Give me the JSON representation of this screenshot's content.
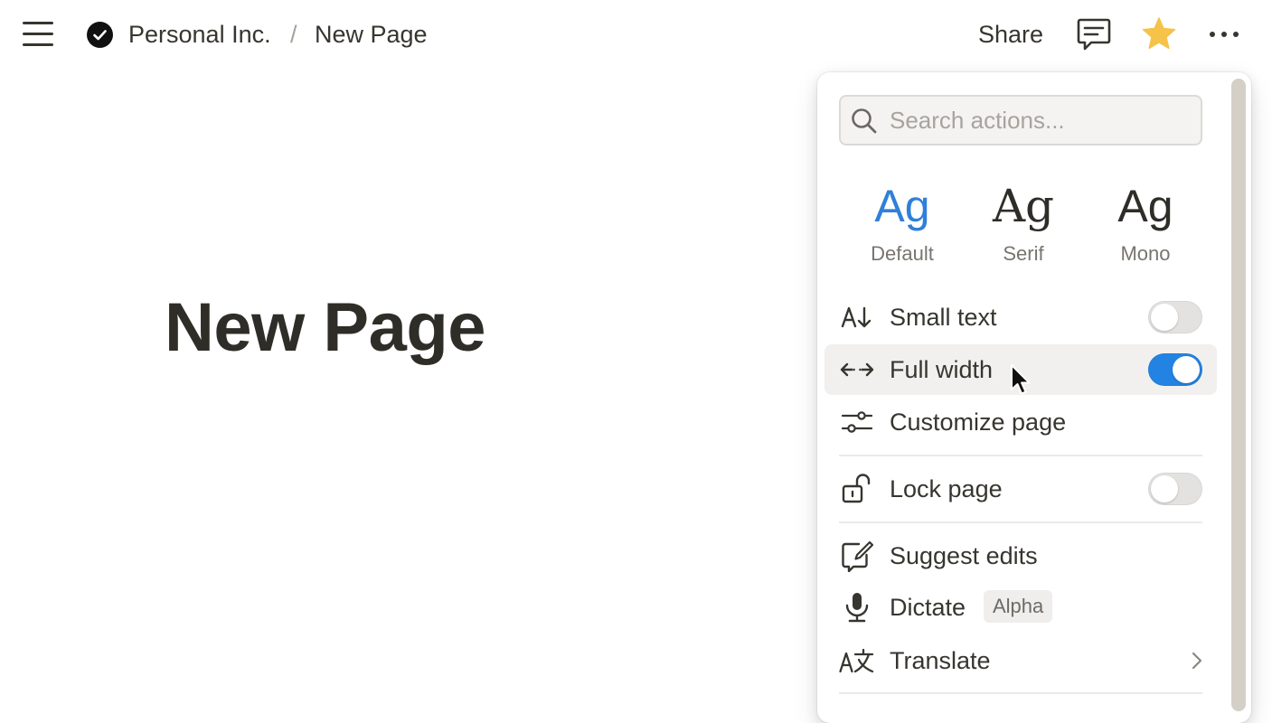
{
  "topbar": {
    "workspace_name": "Personal Inc.",
    "separator": "/",
    "page_name": "New Page",
    "share_label": "Share"
  },
  "page": {
    "title": "New Page"
  },
  "menu": {
    "search_placeholder": "Search actions...",
    "fonts": [
      {
        "sample": "Ag",
        "label": "Default",
        "active": true
      },
      {
        "sample": "Ag",
        "label": "Serif",
        "active": false
      },
      {
        "sample": "Ag",
        "label": "Mono",
        "active": false
      }
    ],
    "items": {
      "small_text": {
        "label": "Small text",
        "toggle": false
      },
      "full_width": {
        "label": "Full width",
        "toggle": true
      },
      "customize_page": {
        "label": "Customize page"
      },
      "lock_page": {
        "label": "Lock page",
        "toggle": false
      },
      "suggest_edits": {
        "label": "Suggest edits"
      },
      "dictate": {
        "label": "Dictate",
        "badge": "Alpha"
      },
      "translate": {
        "label": "Translate"
      }
    }
  },
  "colors": {
    "accent": "#2383e2",
    "favorite_star": "#f5c34a",
    "text": "#37352f"
  },
  "icons": [
    "menu-icon",
    "check-circle-icon",
    "comment-icon",
    "star-icon",
    "more-icon",
    "search-icon",
    "small-text-icon",
    "full-width-icon",
    "customize-icon",
    "lock-icon",
    "suggest-edits-icon",
    "microphone-icon",
    "translate-icon",
    "chevron-right-icon"
  ]
}
